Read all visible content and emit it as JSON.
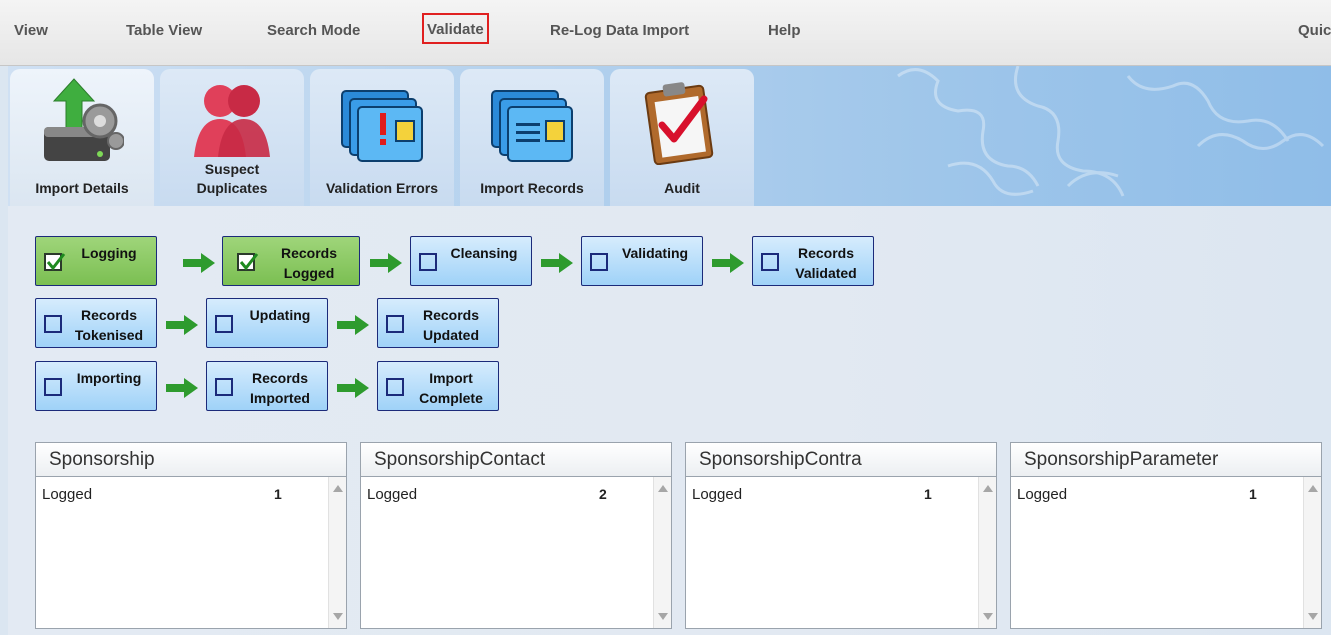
{
  "menu": {
    "items": [
      "View",
      "Table View",
      "Search Mode",
      "Validate",
      "Re-Log Data Import",
      "Help",
      "Quic"
    ]
  },
  "tabs": [
    {
      "label": "Import Details",
      "icon": "server-gear-icon"
    },
    {
      "label": "Suspect Duplicates",
      "icon": "duplicate-people-icon"
    },
    {
      "label": "Validation Errors",
      "icon": "folder-alert-icon"
    },
    {
      "label": "Import Records",
      "icon": "folder-records-icon"
    },
    {
      "label": "Audit",
      "icon": "clipboard-check-icon"
    }
  ],
  "workflow": {
    "rows": [
      [
        {
          "label": "Logging",
          "done": true
        },
        {
          "label": "Records Logged",
          "done": true
        },
        {
          "label": "Cleansing",
          "done": false
        },
        {
          "label": "Validating",
          "done": false
        },
        {
          "label": "Records Validated",
          "done": false
        }
      ],
      [
        {
          "label": "Records Tokenised",
          "done": false
        },
        {
          "label": "Updating",
          "done": false
        },
        {
          "label": "Records Updated",
          "done": false
        }
      ],
      [
        {
          "label": "Importing",
          "done": false
        },
        {
          "label": "Records Imported",
          "done": false
        },
        {
          "label": "Import Complete",
          "done": false
        }
      ]
    ]
  },
  "panels": [
    {
      "title": "Sponsorship",
      "rows": [
        {
          "label": "Logged",
          "count": "1"
        }
      ]
    },
    {
      "title": "SponsorshipContact",
      "rows": [
        {
          "label": "Logged",
          "count": "2"
        }
      ]
    },
    {
      "title": "SponsorshipContra",
      "rows": [
        {
          "label": "Logged",
          "count": "1"
        }
      ]
    },
    {
      "title": "SponsorshipParameter",
      "rows": [
        {
          "label": "Logged",
          "count": "1"
        }
      ]
    }
  ],
  "colors": {
    "step_done": "#7bbf52",
    "step_pending": "#9fd2f8",
    "arrow": "#2e9b2e",
    "highlight_box": "#e02020"
  }
}
